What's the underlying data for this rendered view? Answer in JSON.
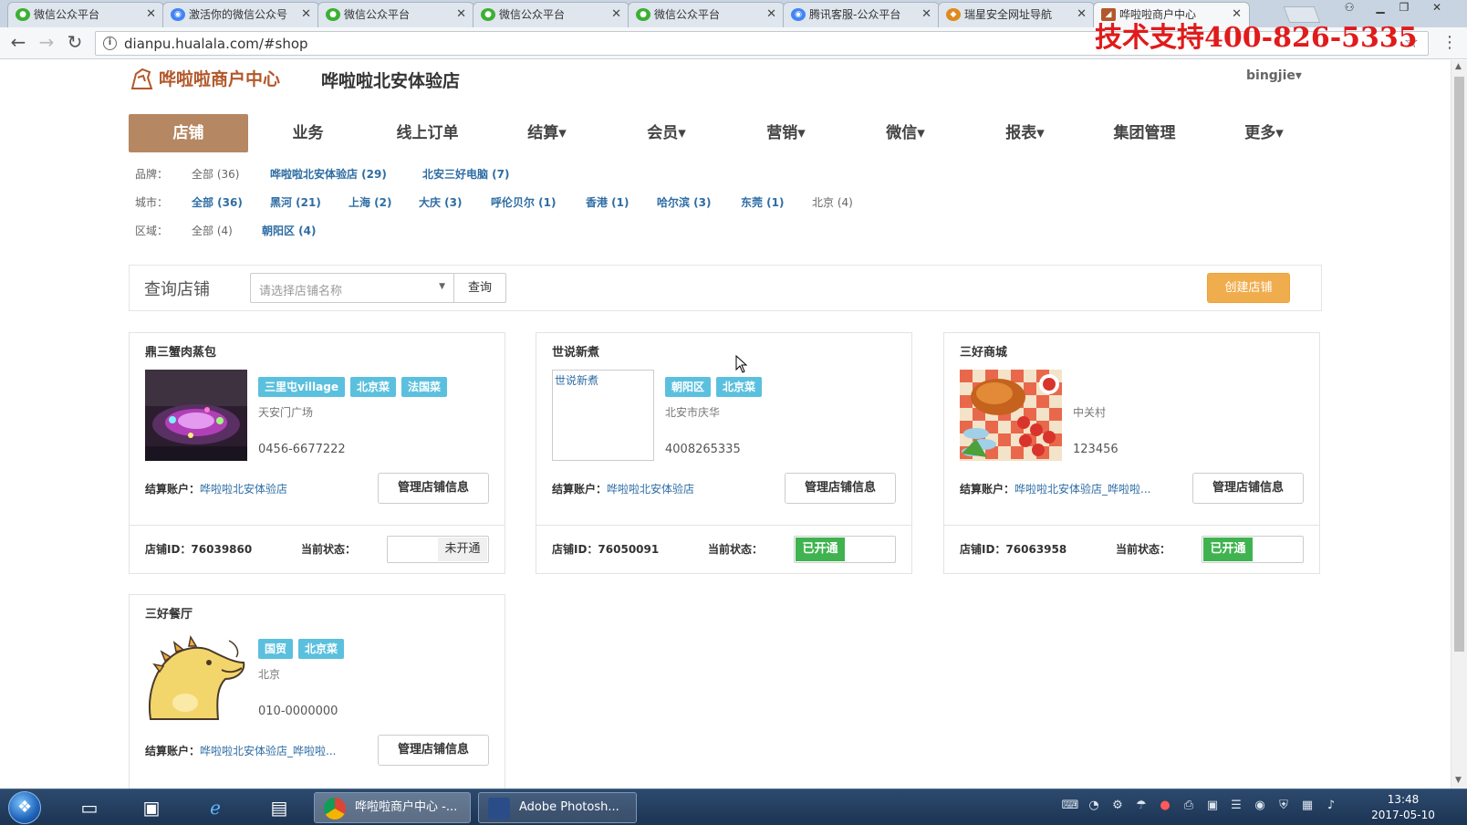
{
  "browser": {
    "tabs": [
      {
        "label": "微信公众平台",
        "icon": "wechat-icon",
        "color": "#3cb034"
      },
      {
        "label": "激活你的微信公众号",
        "icon": "chrome-icon",
        "color": "#4285f4"
      },
      {
        "label": "微信公众平台",
        "icon": "wechat-icon",
        "color": "#3cb034"
      },
      {
        "label": "微信公众平台",
        "icon": "wechat-icon",
        "color": "#3cb034"
      },
      {
        "label": "微信公众平台",
        "icon": "wechat-icon",
        "color": "#3cb034"
      },
      {
        "label": "腾讯客服-公众平台",
        "icon": "chrome-icon",
        "color": "#4285f4"
      },
      {
        "label": "瑞星安全网址导航",
        "icon": "lion-icon",
        "color": "#e08a1e"
      },
      {
        "label": "哗啦啦商户中心",
        "icon": "hualala-icon",
        "color": "#b2582a"
      }
    ],
    "url": "dianpu.hualala.com/#shop",
    "support_text": "技术支持400-826-5335"
  },
  "header": {
    "logo_text": "哗啦啦商户中心",
    "store_name": "哗啦啦北安体验店",
    "user": "bingjie▾"
  },
  "nav": [
    {
      "label": "店铺",
      "active": true
    },
    {
      "label": "业务"
    },
    {
      "label": "线上订单"
    },
    {
      "label": "结算▾"
    },
    {
      "label": "会员▾"
    },
    {
      "label": "营销▾"
    },
    {
      "label": "微信▾"
    },
    {
      "label": "报表▾"
    },
    {
      "label": "集团管理"
    },
    {
      "label": "更多▾"
    }
  ],
  "filters": {
    "brand": {
      "label": "品牌：",
      "options": [
        "全部 (36)",
        "哗啦啦北安体验店 (29)",
        "北安三好电脑 (7)"
      ]
    },
    "city": {
      "label": "城市：",
      "options": [
        "全部 (36)",
        "黑河 (21)",
        "上海 (2)",
        "大庆 (3)",
        "呼伦贝尔 (1)",
        "香港 (1)",
        "哈尔滨 (3)",
        "东莞 (1)",
        "北京 (4)"
      ]
    },
    "district": {
      "label": "区域：",
      "options": [
        "全部 (4)",
        "朝阳区 (4)"
      ]
    }
  },
  "query": {
    "label": "查询店铺",
    "placeholder": "请选择店铺名称",
    "button": "查询",
    "create": "创建店铺"
  },
  "stores": [
    {
      "name": "鼎三蟹肉蒸包",
      "tags": [
        "三里屯village",
        "北京菜",
        "法国菜"
      ],
      "address": "天安门广场",
      "phone": "0456-6677222",
      "account_label": "结算账户：",
      "account": "哗啦啦北安体验店",
      "manage": "管理店铺信息",
      "id_text": "店铺ID：76039860",
      "status_label": "当前状态：",
      "status": "未开通",
      "active": false
    },
    {
      "name": "世说新煮",
      "thumb_text": "世说新煮",
      "tags": [
        "朝阳区",
        "北京菜"
      ],
      "address": "北安市庆华",
      "phone": "4008265335",
      "account_label": "结算账户：",
      "account": "哗啦啦北安体验店",
      "manage": "管理店铺信息",
      "id_text": "店铺ID：76050091",
      "status_label": "当前状态：",
      "status": "已开通",
      "active": true
    },
    {
      "name": "三好商城",
      "tags": [],
      "address": "中关村",
      "phone": "123456",
      "account_label": "结算账户：",
      "account": "哗啦啦北安体验店_哗啦啦...",
      "manage": "管理店铺信息",
      "id_text": "店铺ID：76063958",
      "status_label": "当前状态：",
      "status": "已开通",
      "active": true
    },
    {
      "name": "三好餐厅",
      "tags": [
        "国贸",
        "北京菜"
      ],
      "address": "北京",
      "phone": "010-0000000",
      "account_label": "结算账户：",
      "account": "哗啦啦北安体验店_哗啦啦...",
      "manage": "管理店铺信息"
    }
  ],
  "taskbar": {
    "tasks": [
      {
        "label": "哗啦啦商户中心 -...",
        "active": true
      },
      {
        "label": "Adobe Photosh...",
        "active": false
      }
    ],
    "time": "13:48",
    "date": "2017-05-10"
  },
  "colors": {
    "accent": "#b58762",
    "link": "#2e6da4",
    "tag": "#5bc0de",
    "create": "#f0ad4e",
    "on": "#3fb34f"
  }
}
